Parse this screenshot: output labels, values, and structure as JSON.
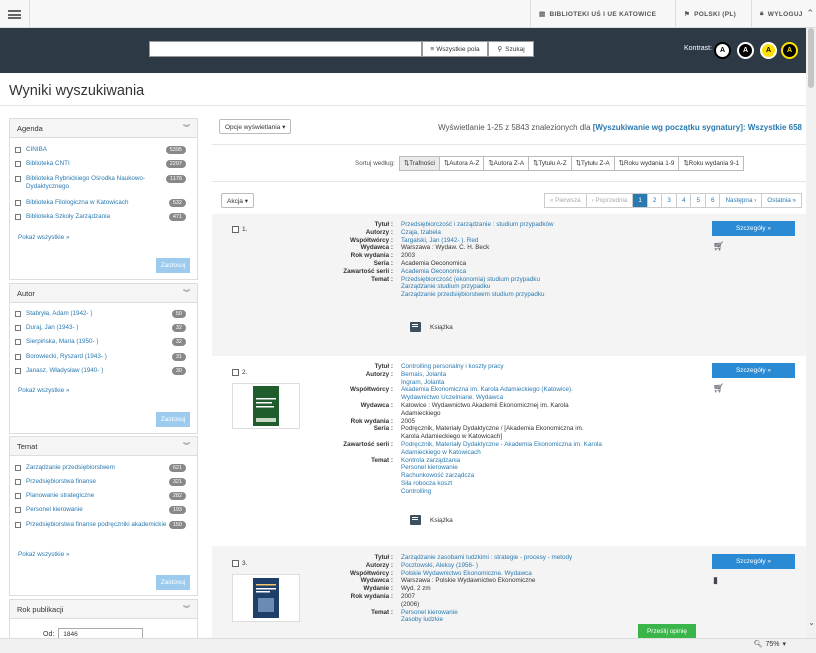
{
  "topnav": {
    "library": "BIBLIOTEKI UŚ I UE KATOWICE",
    "language": "POLSKI (PL)",
    "logout": "WYLOGUJ"
  },
  "search": {
    "placeholder": "",
    "field_select": "Wszystkie pola",
    "button": "Szukaj",
    "contrast_label": "Kontrast:",
    "contrast_options": [
      "A",
      "A",
      "A",
      "A"
    ]
  },
  "page_title": "Wyniki wyszukiwania",
  "facets": {
    "agenda": {
      "title": "Agenda",
      "items": [
        {
          "label": "CINIBA",
          "count": "5395"
        },
        {
          "label": "Biblioteka CNTI",
          "count": "2207"
        },
        {
          "label": "Biblioteka Rybnickiego Ośrodka Naukowo-Dydaktycznego",
          "count": "1176"
        },
        {
          "label": "Biblioteka Filologiczna w Katowicach",
          "count": "532"
        },
        {
          "label": "Biblioteka Szkoły Zarządzania",
          "count": "471"
        }
      ],
      "show_all": "Pokaż wszystkie »",
      "apply": "Zastosuj"
    },
    "author": {
      "title": "Autor",
      "items": [
        {
          "label": "Stabryła, Adam (1942- )",
          "count": "50"
        },
        {
          "label": "Duraj, Jan (1943- )",
          "count": "32"
        },
        {
          "label": "Sierpińska, Maria (1950- )",
          "count": "32"
        },
        {
          "label": "Borowiecki, Ryszard (1943- )",
          "count": "31"
        },
        {
          "label": "Janasz, Władysław (1940- )",
          "count": "30"
        }
      ],
      "show_all": "Pokaż wszystkie »",
      "apply": "Zastosuj"
    },
    "subject": {
      "title": "Temat",
      "items": [
        {
          "label": "Zarządzanie przedsiębiorstwem",
          "count": "621"
        },
        {
          "label": "Przedsiębiorstwa finanse",
          "count": "321"
        },
        {
          "label": "Planowanie strategiczne",
          "count": "282"
        },
        {
          "label": "Personel kierowanie",
          "count": "193"
        },
        {
          "label": "Przedsiębiorstwa finanse podręczniki akademickie",
          "count": "150"
        }
      ],
      "show_all": "Pokaż wszystkie »",
      "apply": "Zastosuj"
    },
    "year": {
      "title": "Rok publikacji",
      "from_label": "Od:",
      "from_value": "1846"
    }
  },
  "toolbar": {
    "view_options": "Opcje wyświetlania ▾",
    "summary_prefix": "Wyświetlanie 1-25 z 5843 znalezionych dla ",
    "summary_query": "[Wyszukiwanie wg początku sygnatury]: Wszystkie 658",
    "sort_label": "Sortuj według:",
    "sort_options": [
      "Trafności",
      "Autora A-Z",
      "Autora Z-A",
      "Tytułu A-Z",
      "Tytułu Z-A",
      "Roku wydania 1-9",
      "Roku wydania 9-1"
    ],
    "action": "Akcja ▾",
    "pager": [
      "« Pierwsza",
      "‹ Poprzednia",
      "1",
      "2",
      "3",
      "4",
      "5",
      "6",
      "Następna ›",
      "Ostatnia »"
    ]
  },
  "records": [
    {
      "num": "1.",
      "fields": [
        {
          "k": "Tytuł :",
          "v": [
            "Przedsiębiorczość i zarządzanie : studium przypadków"
          ],
          "link": true
        },
        {
          "k": "Autorzy :",
          "v": [
            "Czaja, Izabela"
          ],
          "link": true
        },
        {
          "k": "Współtwórcy :",
          "v": [
            "Targalski, Jan (1942- ). Red"
          ],
          "link": true
        },
        {
          "k": "Wydawca :",
          "v": [
            "Warszawa : Wydaw. C. H. Beck"
          ],
          "link": false
        },
        {
          "k": "Rok wydania :",
          "v": [
            "2003"
          ],
          "link": false
        },
        {
          "k": "Seria :",
          "v": [
            "Academia Oeconomica"
          ],
          "link": false
        },
        {
          "k": "Zawartość serii :",
          "v": [
            "Academia Oeconomica"
          ],
          "link": true
        },
        {
          "k": "Temat :",
          "v": [
            "Przedsiębiorczość (ekonomia) studium przypadku",
            "Zarządzanie studium przypadku",
            "Zarządzanie przedsiębiorstwem studium przypadku"
          ],
          "link": true
        }
      ],
      "format": "Książka",
      "details": "Szczegóły »"
    },
    {
      "num": "2.",
      "fields": [
        {
          "k": "Tytuł :",
          "v": [
            "Controlling personalny i koszty pracy"
          ],
          "link": true
        },
        {
          "k": "Autorzy :",
          "v": [
            "Bernais, Jolanta",
            "Ingram, Jolanta"
          ],
          "link": true
        },
        {
          "k": "Współtwórcy :",
          "v": [
            "Akademia Ekonomiczna im. Karola Adamieckiego (Katowice). Wydawnictwo Uczelniane. Wydawca"
          ],
          "link": true
        },
        {
          "k": "Wydawca :",
          "v": [
            "Katowice : Wydawnictwo Akademii Ekonomicznej im. Karola Adamieckiego"
          ],
          "link": false
        },
        {
          "k": "Rok wydania :",
          "v": [
            "2005"
          ],
          "link": false
        },
        {
          "k": "Seria :",
          "v": [
            "Podręcznik, Materiały Dydaktyczne / [Akademia Ekonomiczna im. Karola Adamieckiego w Katowicach]"
          ],
          "link": false
        },
        {
          "k": "Zawartość serii :",
          "v": [
            "Podręcznik, Materiały Dydaktyczne - Akademia Ekonomiczna im. Karola Adamieckiego w Katowicach"
          ],
          "link": true
        },
        {
          "k": "Temat :",
          "v": [
            "Kontrola zarządzania",
            "Personel kierowanie",
            "Rachunkowość zarządcza",
            "Siła robocza koszt",
            "Controlling"
          ],
          "link": true
        }
      ],
      "format": "Książka",
      "details": "Szczegóły »"
    },
    {
      "num": "3.",
      "fields": [
        {
          "k": "Tytuł :",
          "v": [
            "Zarządzanie zasobami ludzkimi : strategie - procesy - metody"
          ],
          "link": true
        },
        {
          "k": "Autorzy :",
          "v": [
            "Pocztowski, Aleksy (1956- )"
          ],
          "link": true
        },
        {
          "k": "Współtwórcy :",
          "v": [
            "Polskie Wydawnictwo Ekonomiczne. Wydawca"
          ],
          "link": true
        },
        {
          "k": "Wydawca :",
          "v": [
            "Warszawa : Polskie Wydawnictwo Ekonomiczne"
          ],
          "link": false
        },
        {
          "k": "Wydanie :",
          "v": [
            "Wyd. 2 zm"
          ],
          "link": false
        },
        {
          "k": "Rok wydania :",
          "v": [
            "2007",
            "(2006)"
          ],
          "link": false
        },
        {
          "k": "Temat :",
          "v": [
            "Personel kierowanie",
            "Zasoby ludzkie"
          ],
          "link": true
        }
      ],
      "details": "Szczegóły »"
    }
  ],
  "opinion_button": "Prześlij opinię",
  "zoom": "75%",
  "colors": {
    "header_dark": "#2d3a46",
    "link": "#2a7ab0",
    "primary_button": "#2a8ad4",
    "apply_button": "#9dcbee",
    "feedback_button": "#3ab54a"
  }
}
